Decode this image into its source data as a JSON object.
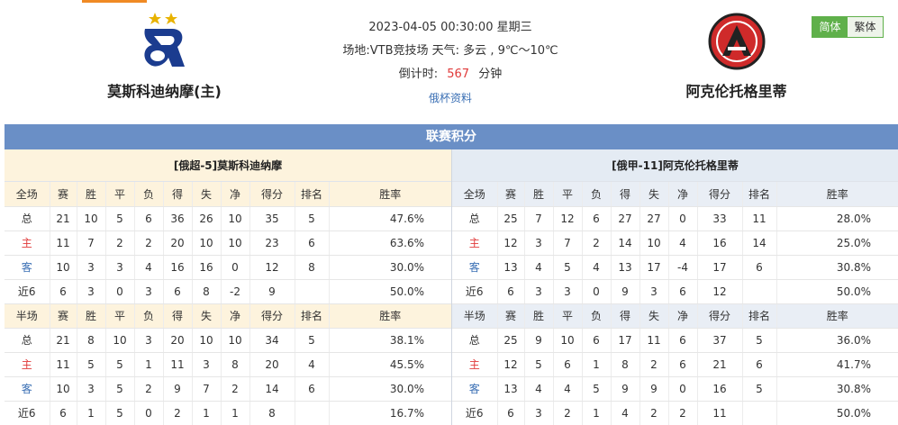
{
  "header": {
    "home_team": "莫斯科迪纳摩(主)",
    "away_team": "阿克伦托格里蒂",
    "datetime": "2023-04-05 00:30:00 星期三",
    "venue_weather": "场地:VTB竞技场 天气: 多云 , 9℃～10℃",
    "countdown_label": "倒计时:",
    "countdown_value": "567",
    "countdown_unit": "分钟",
    "cup_link": "俄杯资料",
    "lang_simplified": "简体",
    "lang_traditional": "繁体",
    "home_logo_icon": "dynamo-moscow-logo",
    "away_logo_icon": "akron-togliatti-logo",
    "colors": {
      "accent_green": "#5fb04a",
      "section_blue": "#6a8fc6",
      "home_red": "#e03a3a",
      "away_blue": "#3a6fb4"
    }
  },
  "section_title": "联赛积分",
  "columns_full": [
    "全场",
    "赛",
    "胜",
    "平",
    "负",
    "得",
    "失",
    "净",
    "得分",
    "排名",
    "胜率"
  ],
  "columns_half": [
    "半场",
    "赛",
    "胜",
    "平",
    "负",
    "得",
    "失",
    "净",
    "得分",
    "排名",
    "胜率"
  ],
  "left": {
    "title": "[俄超-5]莫斯科迪纳摩",
    "full": [
      [
        "总",
        "21",
        "10",
        "5",
        "6",
        "36",
        "26",
        "10",
        "35",
        "5",
        "47.6%"
      ],
      [
        "主",
        "11",
        "7",
        "2",
        "2",
        "20",
        "10",
        "10",
        "23",
        "6",
        "63.6%"
      ],
      [
        "客",
        "10",
        "3",
        "3",
        "4",
        "16",
        "16",
        "0",
        "12",
        "8",
        "30.0%"
      ],
      [
        "近6",
        "6",
        "3",
        "0",
        "3",
        "6",
        "8",
        "-2",
        "9",
        "",
        "50.0%"
      ]
    ],
    "half": [
      [
        "总",
        "21",
        "8",
        "10",
        "3",
        "20",
        "10",
        "10",
        "34",
        "5",
        "38.1%"
      ],
      [
        "主",
        "11",
        "5",
        "5",
        "1",
        "11",
        "3",
        "8",
        "20",
        "4",
        "45.5%"
      ],
      [
        "客",
        "10",
        "3",
        "5",
        "2",
        "9",
        "7",
        "2",
        "14",
        "6",
        "30.0%"
      ],
      [
        "近6",
        "6",
        "1",
        "5",
        "0",
        "2",
        "1",
        "1",
        "8",
        "",
        "16.7%"
      ]
    ]
  },
  "right": {
    "title": "[俄甲-11]阿克伦托格里蒂",
    "full": [
      [
        "总",
        "25",
        "7",
        "12",
        "6",
        "27",
        "27",
        "0",
        "33",
        "11",
        "28.0%"
      ],
      [
        "主",
        "12",
        "3",
        "7",
        "2",
        "14",
        "10",
        "4",
        "16",
        "14",
        "25.0%"
      ],
      [
        "客",
        "13",
        "4",
        "5",
        "4",
        "13",
        "17",
        "-4",
        "17",
        "6",
        "30.8%"
      ],
      [
        "近6",
        "6",
        "3",
        "3",
        "0",
        "9",
        "3",
        "6",
        "12",
        "",
        "50.0%"
      ]
    ],
    "half": [
      [
        "总",
        "25",
        "9",
        "10",
        "6",
        "17",
        "11",
        "6",
        "37",
        "5",
        "36.0%"
      ],
      [
        "主",
        "12",
        "5",
        "6",
        "1",
        "8",
        "2",
        "6",
        "21",
        "6",
        "41.7%"
      ],
      [
        "客",
        "13",
        "4",
        "4",
        "5",
        "9",
        "9",
        "0",
        "16",
        "5",
        "30.8%"
      ],
      [
        "近6",
        "6",
        "3",
        "2",
        "1",
        "4",
        "2",
        "2",
        "11",
        "",
        "50.0%"
      ]
    ]
  }
}
